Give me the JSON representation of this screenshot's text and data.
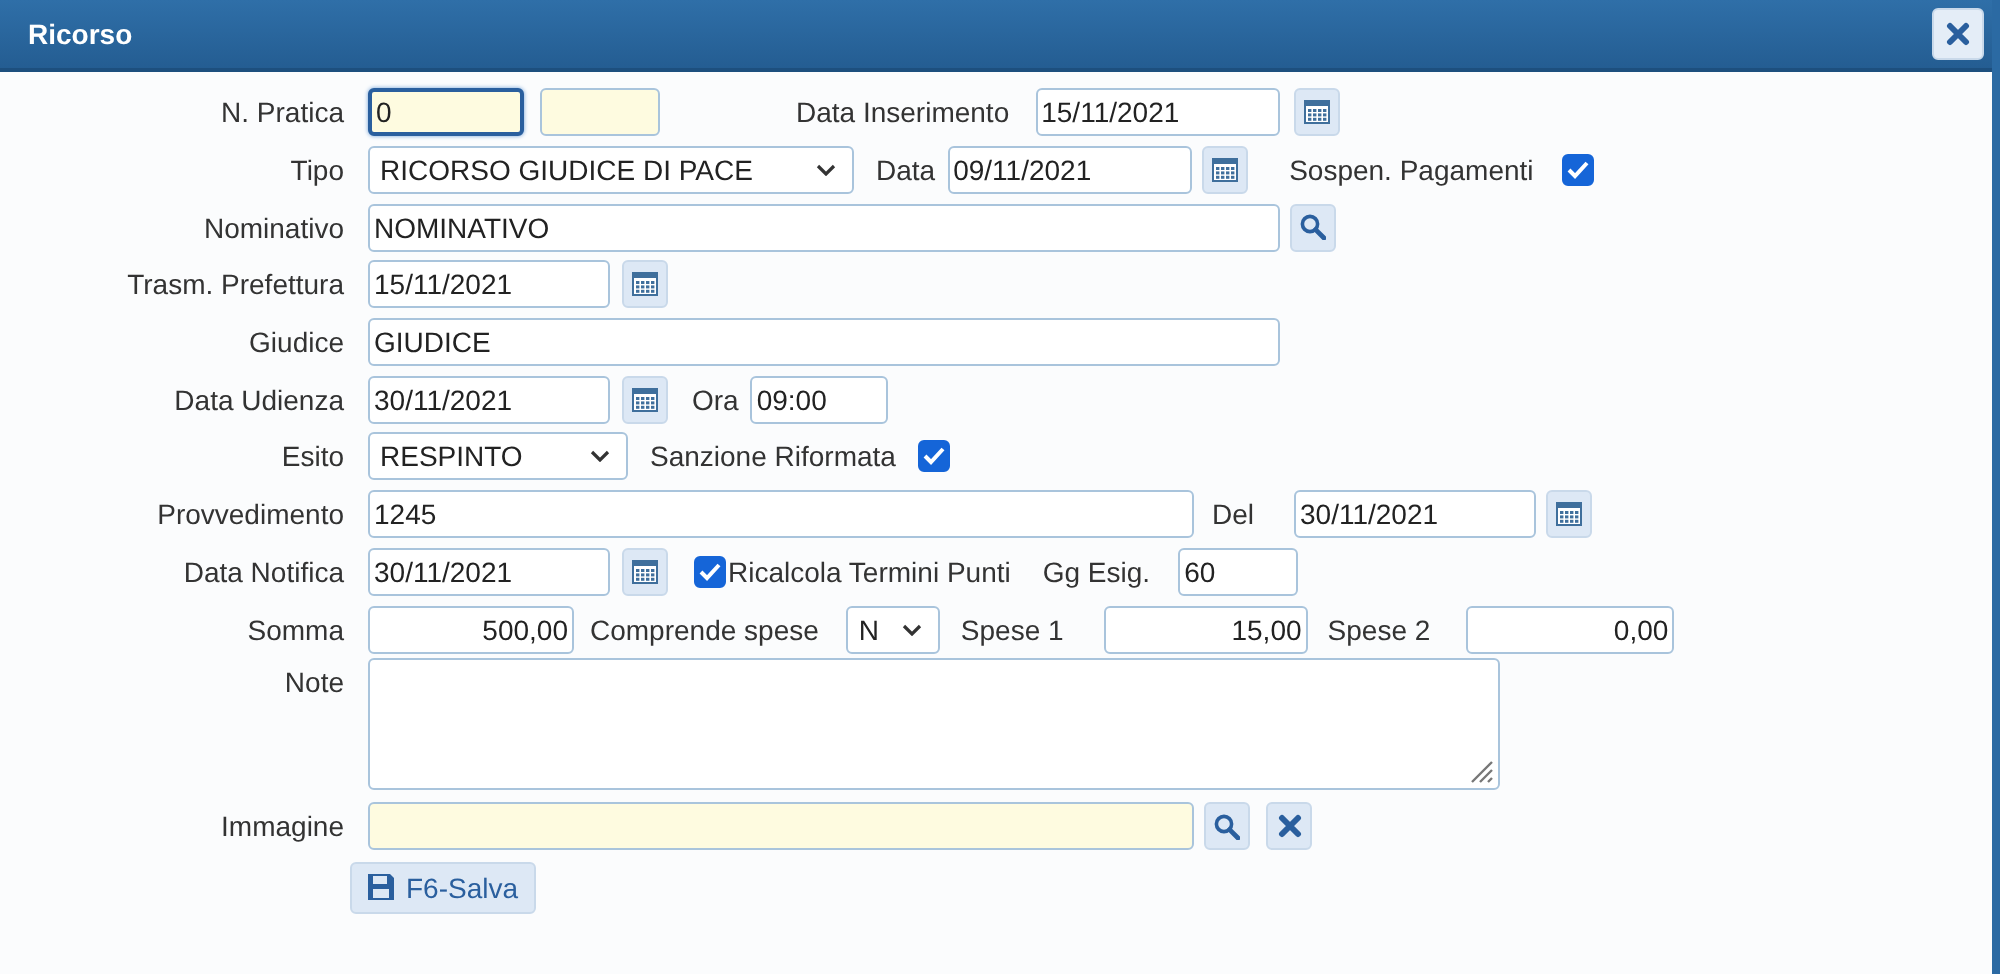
{
  "dialog": {
    "title": "Ricorso"
  },
  "form": {
    "n_pratica": {
      "label": "N. Pratica",
      "value": "0",
      "focused": true
    },
    "data_inserimento": {
      "label": "Data Inserimento",
      "value": "15/11/2021"
    },
    "tipo": {
      "label": "Tipo",
      "value": "RICORSO GIUDICE DI PACE"
    },
    "data": {
      "label": "Data",
      "value": "09/11/2021"
    },
    "sospen_pagamenti": {
      "label": "Sospen. Pagamenti",
      "checked": true
    },
    "nominativo": {
      "label": "Nominativo",
      "value": "NOMINATIVO"
    },
    "trasm_prefettura": {
      "label": "Trasm. Prefettura",
      "value": "15/11/2021"
    },
    "giudice": {
      "label": "Giudice",
      "value": "GIUDICE"
    },
    "data_udienza": {
      "label": "Data Udienza",
      "value": "30/11/2021"
    },
    "ora": {
      "label": "Ora",
      "value": "09:00"
    },
    "esito": {
      "label": "Esito",
      "value": "RESPINTO"
    },
    "sanzione_riformata": {
      "label": "Sanzione Riformata",
      "checked": true
    },
    "provvedimento": {
      "label": "Provvedimento",
      "value": "1245"
    },
    "del": {
      "label": "Del",
      "value": "30/11/2021"
    },
    "data_notifica": {
      "label": "Data Notifica",
      "value": "30/11/2021"
    },
    "ricalcola_termini_punti": {
      "label": "Ricalcola Termini Punti",
      "checked": true
    },
    "gg_esig": {
      "label": "Gg Esig.",
      "value": "60"
    },
    "somma": {
      "label": "Somma",
      "value": "500,00"
    },
    "comprende_spese": {
      "label": "Comprende spese",
      "value": "N"
    },
    "spese_1": {
      "label": "Spese 1",
      "value": "15,00"
    },
    "spese_2": {
      "label": "Spese 2",
      "value": "0,00"
    },
    "note": {
      "label": "Note"
    },
    "immagine": {
      "label": "Immagine"
    }
  },
  "save_button": {
    "label": "F6-Salva"
  }
}
